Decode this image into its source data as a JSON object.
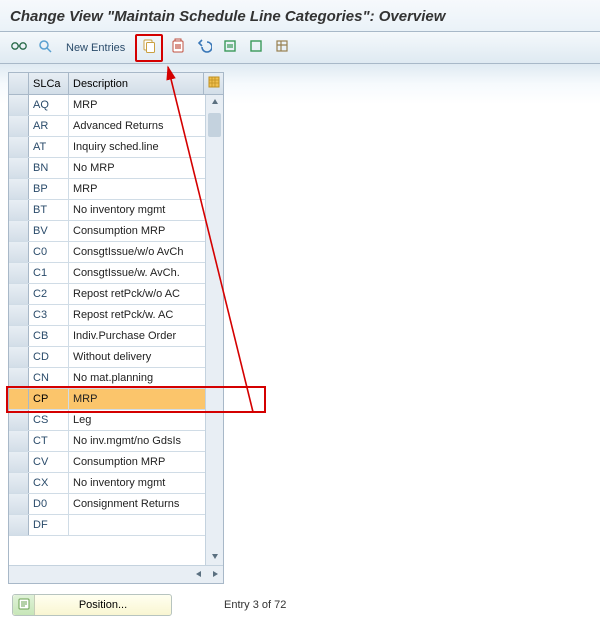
{
  "title": "Change View \"Maintain Schedule Line Categories\": Overview",
  "toolbar": {
    "new_entries_label": "New Entries"
  },
  "grid": {
    "headers": {
      "code": "SLCa",
      "desc": "Description"
    },
    "rows": [
      {
        "code": "AQ",
        "desc": "MRP",
        "selected": false
      },
      {
        "code": "AR",
        "desc": "Advanced Returns",
        "selected": false
      },
      {
        "code": "AT",
        "desc": "Inquiry sched.line",
        "selected": false
      },
      {
        "code": "BN",
        "desc": "No MRP",
        "selected": false
      },
      {
        "code": "BP",
        "desc": "MRP",
        "selected": false
      },
      {
        "code": "BT",
        "desc": "No inventory mgmt",
        "selected": false
      },
      {
        "code": "BV",
        "desc": "Consumption MRP",
        "selected": false
      },
      {
        "code": "C0",
        "desc": "ConsgtIssue/w/o AvCh",
        "selected": false
      },
      {
        "code": "C1",
        "desc": "ConsgtIssue/w. AvCh.",
        "selected": false
      },
      {
        "code": "C2",
        "desc": "Repost retPck/w/o AC",
        "selected": false
      },
      {
        "code": "C3",
        "desc": "Repost retPck/w. AC",
        "selected": false
      },
      {
        "code": "CB",
        "desc": "Indiv.Purchase Order",
        "selected": false
      },
      {
        "code": "CD",
        "desc": "Without delivery",
        "selected": false
      },
      {
        "code": "CN",
        "desc": "No mat.planning",
        "selected": false
      },
      {
        "code": "CP",
        "desc": "MRP",
        "selected": true
      },
      {
        "code": "CS",
        "desc": "Leg",
        "selected": false
      },
      {
        "code": "CT",
        "desc": "No inv.mgmt/no GdsIs",
        "selected": false
      },
      {
        "code": "CV",
        "desc": "Consumption MRP",
        "selected": false
      },
      {
        "code": "CX",
        "desc": "No inventory mgmt",
        "selected": false
      },
      {
        "code": "D0",
        "desc": "Consignment Returns",
        "selected": false
      },
      {
        "code": "DF",
        "desc": "",
        "selected": false
      }
    ]
  },
  "footer": {
    "position_label": "Position...",
    "entry_status": "Entry 3 of 72"
  }
}
